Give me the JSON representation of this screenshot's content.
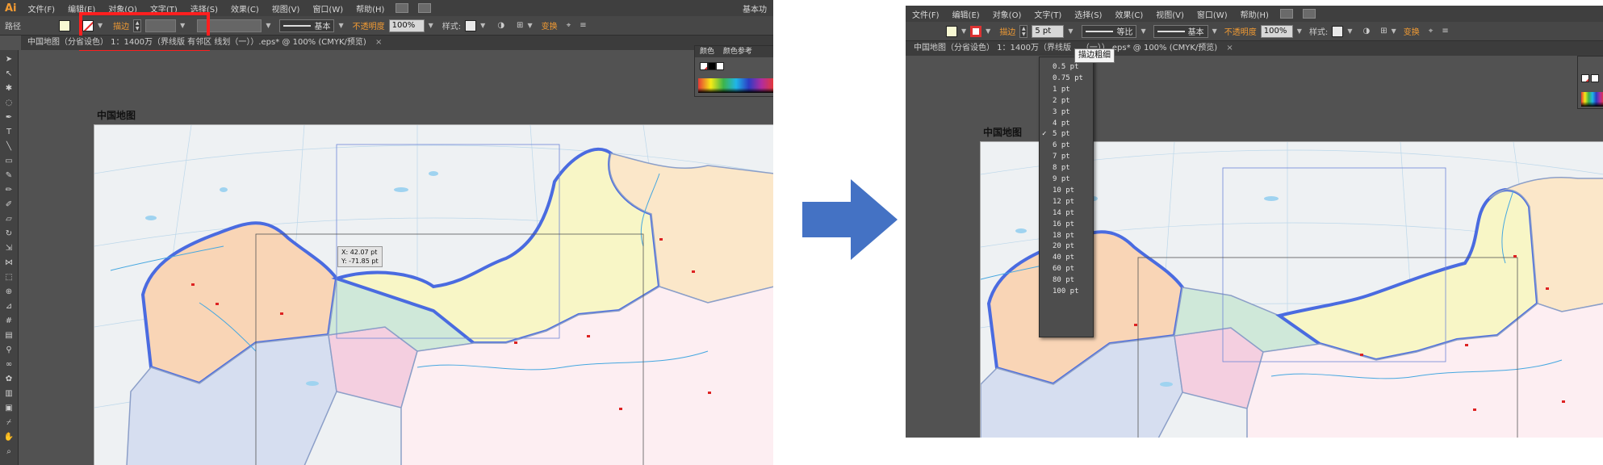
{
  "menu": {
    "app_logo": "Ai",
    "items": [
      "文件(F)",
      "编辑(E)",
      "对象(O)",
      "文字(T)",
      "选择(S)",
      "效果(C)",
      "视图(V)",
      "窗口(W)",
      "帮助(H)"
    ],
    "workspace_label": "基本功"
  },
  "control_bar": {
    "path_label": "路径",
    "stroke_label": "描边",
    "stroke_style_basic": "基本",
    "stroke_style_ratio": "等比",
    "opacity_label": "不透明度",
    "opacity_value": "100%",
    "style_label": "样式:",
    "transform_label": "变换",
    "stroke_weight_value": "5 pt"
  },
  "document_tab": {
    "title_left": "中国地图（分省设色） 1：1400万（界线版 有邻区 线划（一））.eps* @ 100% (CMYK/预览)",
    "title_right": "中国地图（分省设色） 1：1400万（界线版 ...（一））.eps* @ 100% (CMYK/预览)",
    "close": "×"
  },
  "color_panel": {
    "tab_color": "颜色",
    "tab_color_ref": "颜色参考"
  },
  "map": {
    "title": "中国地图",
    "colors": {
      "xinjiang": "#f9d5b6",
      "neimenggu": "#f8f6c6",
      "xizang": "#d6def0",
      "qinghai": "#f4cfe0",
      "gansu": "#cfe8d9",
      "lake": "#9fd3f0",
      "border": "#4a6be0"
    }
  },
  "coordinate_tooltip": {
    "x": "X: 42.07 pt",
    "y": "Y: -71.85 pt"
  },
  "tooltip": {
    "text": "描边粗细"
  },
  "stroke_weight_menu": {
    "items": [
      "0.5 pt",
      "0.75 pt",
      "1 pt",
      "2 pt",
      "3 pt",
      "4 pt",
      "5 pt",
      "6 pt",
      "7 pt",
      "8 pt",
      "9 pt",
      "10 pt",
      "12 pt",
      "14 pt",
      "16 pt",
      "18 pt",
      "20 pt",
      "40 pt",
      "60 pt",
      "80 pt",
      "100 pt"
    ],
    "selected": "5 pt"
  },
  "arrow": {
    "color": "#4472c4"
  }
}
